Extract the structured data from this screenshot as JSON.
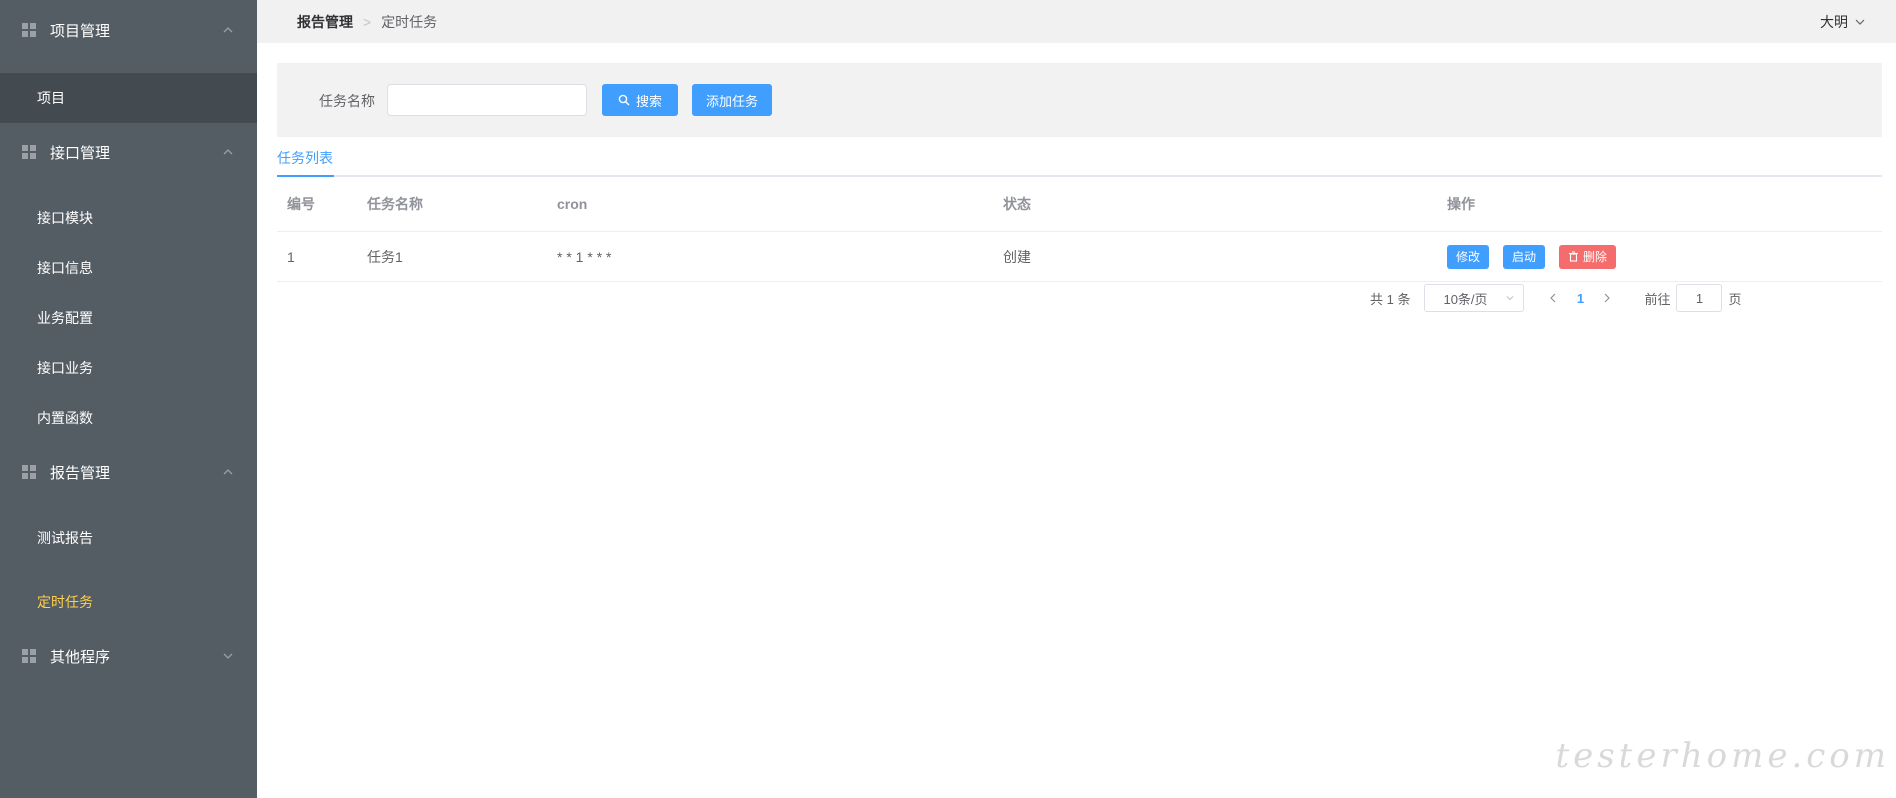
{
  "sidebar": {
    "groups": [
      {
        "label": "项目管理",
        "expanded": true,
        "icon": "grid-icon",
        "items": [
          {
            "label": "项目"
          }
        ]
      },
      {
        "label": "接口管理",
        "expanded": true,
        "icon": "grid-icon",
        "items": [
          {
            "label": "接口模块"
          },
          {
            "label": "接口信息"
          },
          {
            "label": "业务配置"
          },
          {
            "label": "接口业务"
          },
          {
            "label": "内置函数"
          }
        ]
      },
      {
        "label": "报告管理",
        "expanded": true,
        "icon": "grid-icon",
        "items": [
          {
            "label": "测试报告"
          },
          {
            "label": "定时任务"
          }
        ]
      },
      {
        "label": "其他程序",
        "expanded": false,
        "icon": "grid-icon",
        "items": []
      }
    ],
    "active_item": "定时任务",
    "colors": {
      "background": "#545c64",
      "active_text": "#ffd04b",
      "selected_bg": "#434a50"
    }
  },
  "header": {
    "breadcrumb": {
      "parent": "报告管理",
      "separator": ">",
      "current": "定时任务"
    },
    "user": {
      "name": "大明",
      "icon": "chevron-down-icon"
    }
  },
  "search": {
    "label": "任务名称",
    "input_value": "",
    "input_placeholder": "",
    "search_button": "搜索",
    "add_button": "添加任务"
  },
  "tabs": {
    "active": "任务列表"
  },
  "table": {
    "columns": [
      "编号",
      "任务名称",
      "cron",
      "状态",
      "操作"
    ],
    "rows": [
      {
        "id": "1",
        "name": "任务1",
        "cron": "* * 1 * * *",
        "status": "创建",
        "actions": {
          "edit": "修改",
          "start": "启动",
          "delete": "删除"
        }
      }
    ]
  },
  "pagination": {
    "total_text": "共 1 条",
    "page_size": "10条/页",
    "current_page": "1",
    "goto_label": "前往",
    "goto_value": "1",
    "page_suffix": "页"
  },
  "watermark": "testerhome.com",
  "accent_color": "#409eff",
  "danger_color": "#f56c6c"
}
